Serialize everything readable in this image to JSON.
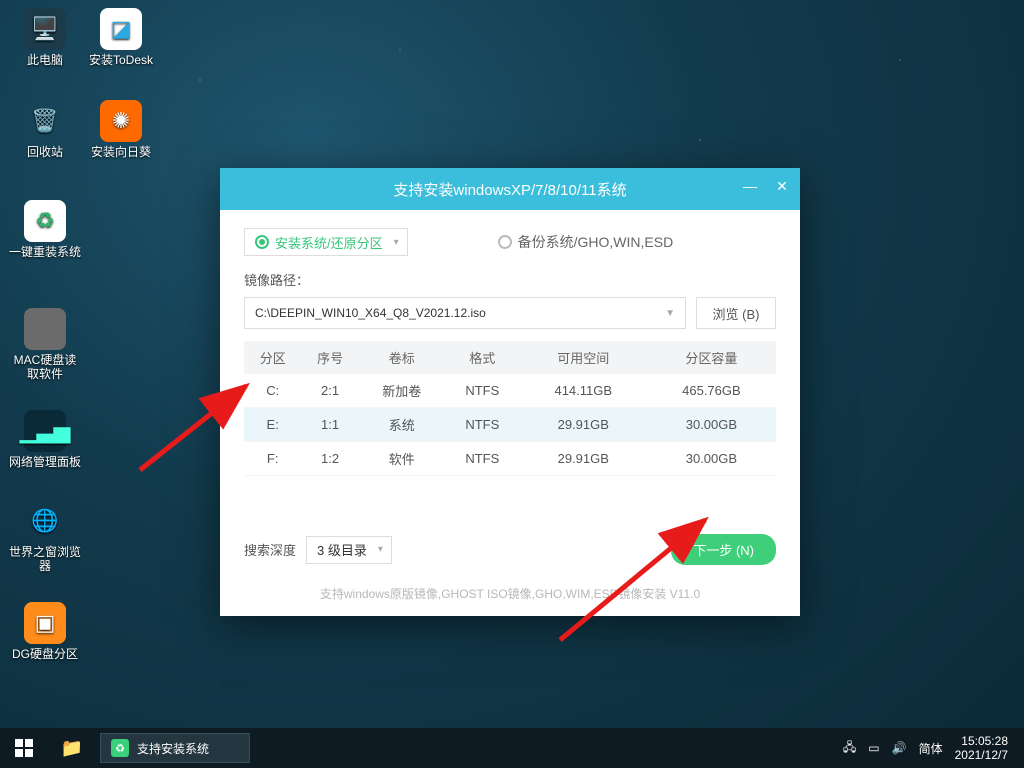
{
  "desktop_icons": [
    {
      "id": "this-pc",
      "label": "此电脑",
      "bg": "#1b3a4a",
      "glyph": "🖥"
    },
    {
      "id": "install-todesk",
      "label": "安装ToDesk",
      "bg": "#ffffff",
      "glyph": "🟦"
    },
    {
      "id": "recycle-bin",
      "label": "回收站",
      "bg": "#1b3a4a",
      "glyph": "🗑"
    },
    {
      "id": "install-sunflower",
      "label": "安装向日葵",
      "bg": "#ff6a00",
      "glyph": "✺"
    },
    {
      "id": "onekey-reinstall",
      "label": "一键重装系统",
      "bg": "#ffffff",
      "glyph": "🔄"
    },
    {
      "id": "mac-disk-reader",
      "label": "MAC硬盘读\n取软件",
      "bg": "#6b6b6b",
      "glyph": ""
    },
    {
      "id": "network-panel",
      "label": "网络管理面板",
      "bg": "#0b2a38",
      "glyph": "📊"
    },
    {
      "id": "theworld-browser",
      "label": "世界之窗浏览\n器",
      "bg": "#123b4d",
      "glyph": "🌐"
    },
    {
      "id": "dg-partition",
      "label": "DG硬盘分区",
      "bg": "#ff8c1a",
      "glyph": "▣"
    }
  ],
  "window": {
    "title": "支持安装windowsXP/7/8/10/11系统",
    "radio_install": "安装系统/还原分区",
    "radio_backup": "备份系统/GHO,WIN,ESD",
    "path_label": "镜像路径：",
    "path_value": "C:\\DEEPIN_WIN10_X64_Q8_V2021.12.iso",
    "browse": "浏览 (B)",
    "columns": [
      "分区",
      "序号",
      "卷标",
      "格式",
      "可用空间",
      "分区容量"
    ],
    "rows": [
      {
        "drive": "C:",
        "num": "2:1",
        "label": "新加卷",
        "fmt": "NTFS",
        "free": "414.11GB",
        "total": "465.76GB",
        "selected": false
      },
      {
        "drive": "E:",
        "num": "1:1",
        "label": "系统",
        "fmt": "NTFS",
        "free": "29.91GB",
        "total": "30.00GB",
        "selected": true
      },
      {
        "drive": "F:",
        "num": "1:2",
        "label": "软件",
        "fmt": "NTFS",
        "free": "29.91GB",
        "total": "30.00GB",
        "selected": false
      }
    ],
    "depth_label": "搜索深度",
    "depth_value": "3 级目录",
    "next": "下一步 (N)",
    "hint": "支持windows原版镜像,GHOST ISO镜像,GHO,WIM,ESD镜像安装  V11.0"
  },
  "taskbar": {
    "task_label": "支持安装系统",
    "ime": "简体",
    "time": "15:05:28",
    "date": "2021/12/7"
  }
}
